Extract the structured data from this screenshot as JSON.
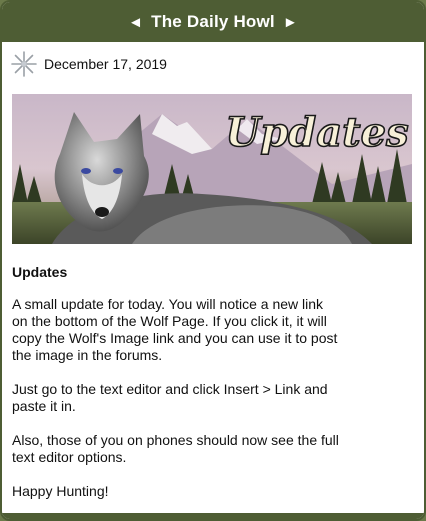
{
  "header": {
    "title": "The Daily Howl",
    "prev_icon": "◄",
    "next_icon": "►"
  },
  "post": {
    "date": "December 17, 2019",
    "banner_text": "Updates",
    "heading": "Updates",
    "paragraphs": [
      "A small update for today. You will notice a new link on the bottom of the Wolf Page. If you click it, it will copy the Wolf's Image link and you can use it to post the image in the forums.",
      "Just go to the text editor and click Insert > Link and paste it in.",
      "Also, those of you on phones should now see the full text editor options.",
      "Happy Hunting!"
    ]
  },
  "colors": {
    "header_bg": "#4e5d34",
    "text": "#111111"
  }
}
